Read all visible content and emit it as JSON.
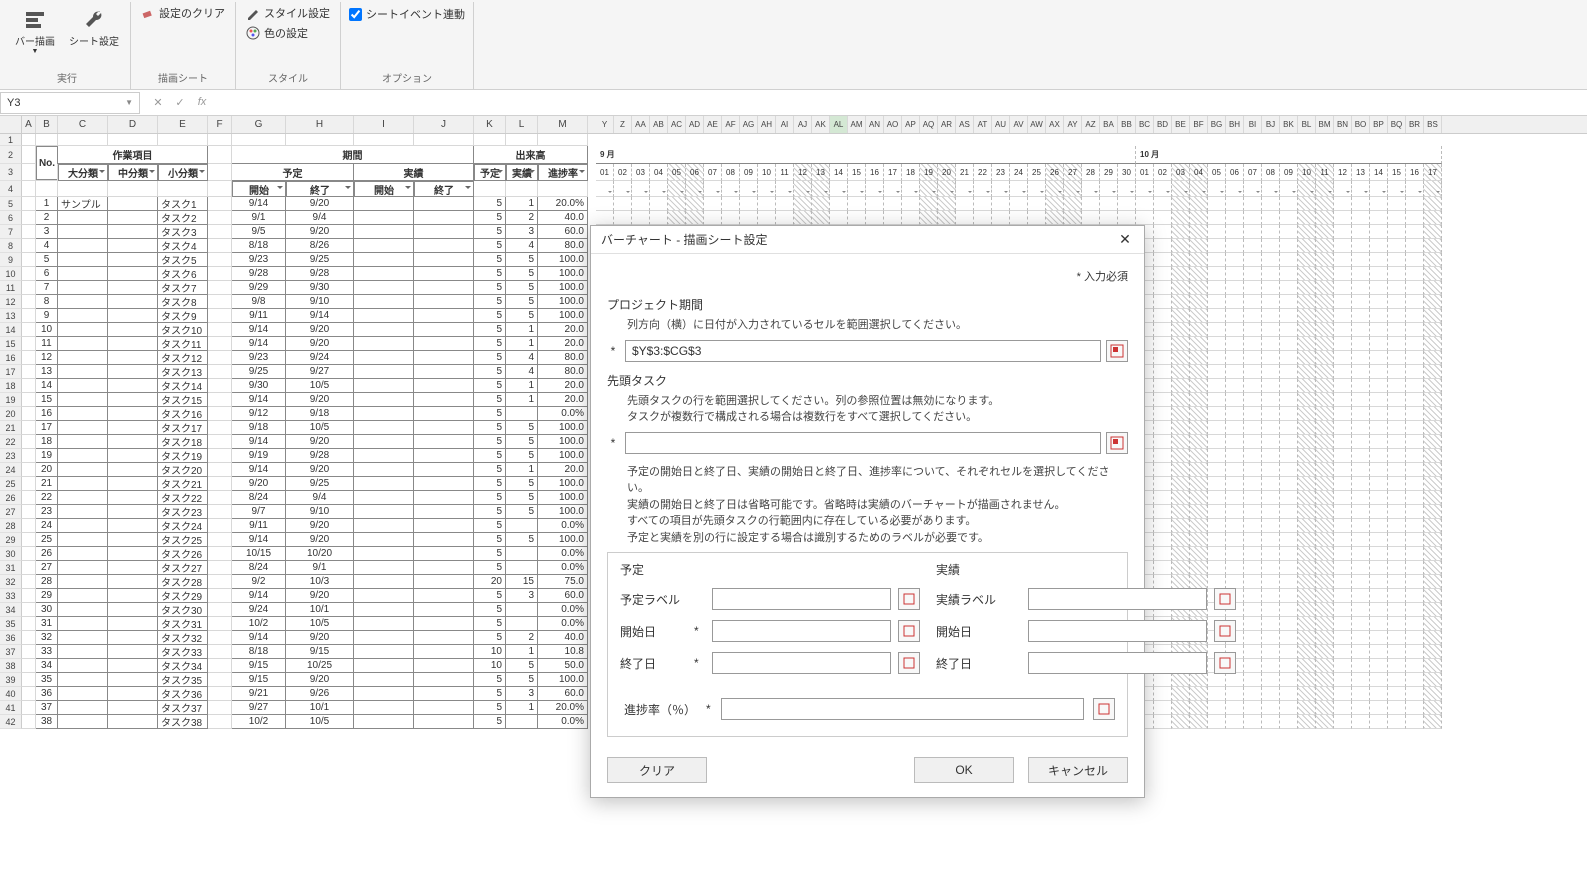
{
  "ribbon": {
    "group1": {
      "btn_bar": "バー描画",
      "btn_sheet": "シート設定",
      "label": "実行"
    },
    "group2": {
      "clear": "設定のクリア",
      "label": "描画シート"
    },
    "group3": {
      "style": "スタイル設定",
      "color": "色の設定",
      "label": "スタイル"
    },
    "group4": {
      "chk": "シートイベント連動",
      "label": "オプション"
    }
  },
  "formula": {
    "name": "Y3",
    "fx": "fx",
    "value": ""
  },
  "headers": {
    "main_cols": [
      "A",
      "B",
      "C",
      "D",
      "E",
      "F",
      "G",
      "H",
      "I",
      "J",
      "K",
      "L",
      "M"
    ],
    "tl_cols": [
      "Y",
      "Z",
      "AA",
      "AB",
      "AC",
      "AD",
      "AE",
      "AF",
      "AG",
      "AH",
      "AI",
      "AJ",
      "AK",
      "AL",
      "AM",
      "AN",
      "AO",
      "AP",
      "AQ",
      "AR",
      "AS",
      "AT",
      "AU",
      "AV",
      "AW",
      "AX",
      "AY",
      "AZ",
      "BA",
      "BB",
      "BC",
      "BD",
      "BE",
      "BF",
      "BG",
      "BH",
      "BI",
      "BJ",
      "BK",
      "BL",
      "BM",
      "BN",
      "BO",
      "BP",
      "BQ",
      "BR",
      "BS"
    ]
  },
  "table_hdr": {
    "no": "No.",
    "sagyo": "作業項目",
    "dai": "大分類",
    "chu": "中分類",
    "sho": "小分類",
    "kikan": "期間",
    "yotei": "予定",
    "jisseki": "実績",
    "kaishi": "開始",
    "shuryo": "終了",
    "dekidaka": "出来高",
    "shinchoku": "進捗率"
  },
  "months": {
    "m9": "9 月",
    "m10": "10 月"
  },
  "days9": [
    "01",
    "02",
    "03",
    "04",
    "05",
    "06",
    "07",
    "08",
    "09",
    "10",
    "11",
    "12",
    "13",
    "14",
    "15",
    "16",
    "17",
    "18",
    "19",
    "20",
    "21",
    "22",
    "23",
    "24",
    "25",
    "26",
    "27",
    "28",
    "29",
    "30"
  ],
  "days10": [
    "01",
    "02",
    "03",
    "04",
    "05",
    "06",
    "07",
    "08",
    "09",
    "10",
    "11",
    "12",
    "13",
    "14",
    "15",
    "16",
    "17"
  ],
  "tasks": [
    {
      "no": 1,
      "dai": "サンプル",
      "sho": "タスク1",
      "ps": "9/14",
      "pe": "9/20",
      "y": 5,
      "j": 1,
      "p": "20.0%"
    },
    {
      "no": 2,
      "dai": "",
      "sho": "タスク2",
      "ps": "9/1",
      "pe": "9/4",
      "y": 5,
      "j": 2,
      "p": "40.0"
    },
    {
      "no": 3,
      "dai": "",
      "sho": "タスク3",
      "ps": "9/5",
      "pe": "9/20",
      "y": 5,
      "j": 3,
      "p": "60.0"
    },
    {
      "no": 4,
      "dai": "",
      "sho": "タスク4",
      "ps": "8/18",
      "pe": "8/26",
      "y": 5,
      "j": 4,
      "p": "80.0"
    },
    {
      "no": 5,
      "dai": "",
      "sho": "タスク5",
      "ps": "9/23",
      "pe": "9/25",
      "y": 5,
      "j": 5,
      "p": "100.0"
    },
    {
      "no": 6,
      "dai": "",
      "sho": "タスク6",
      "ps": "9/28",
      "pe": "9/28",
      "y": 5,
      "j": 5,
      "p": "100.0"
    },
    {
      "no": 7,
      "dai": "",
      "sho": "タスク7",
      "ps": "9/29",
      "pe": "9/30",
      "y": 5,
      "j": 5,
      "p": "100.0"
    },
    {
      "no": 8,
      "dai": "",
      "sho": "タスク8",
      "ps": "9/8",
      "pe": "9/10",
      "y": 5,
      "j": 5,
      "p": "100.0"
    },
    {
      "no": 9,
      "dai": "",
      "sho": "タスク9",
      "ps": "9/11",
      "pe": "9/14",
      "y": 5,
      "j": 5,
      "p": "100.0"
    },
    {
      "no": 10,
      "dai": "",
      "sho": "タスク10",
      "ps": "9/14",
      "pe": "9/20",
      "y": 5,
      "j": 1,
      "p": "20.0"
    },
    {
      "no": 11,
      "dai": "",
      "sho": "タスク11",
      "ps": "9/14",
      "pe": "9/20",
      "y": 5,
      "j": 1,
      "p": "20.0"
    },
    {
      "no": 12,
      "dai": "",
      "sho": "タスク12",
      "ps": "9/23",
      "pe": "9/24",
      "y": 5,
      "j": 4,
      "p": "80.0"
    },
    {
      "no": 13,
      "dai": "",
      "sho": "タスク13",
      "ps": "9/25",
      "pe": "9/27",
      "y": 5,
      "j": 4,
      "p": "80.0"
    },
    {
      "no": 14,
      "dai": "",
      "sho": "タスク14",
      "ps": "9/30",
      "pe": "10/5",
      "y": 5,
      "j": 1,
      "p": "20.0"
    },
    {
      "no": 15,
      "dai": "",
      "sho": "タスク15",
      "ps": "9/14",
      "pe": "9/20",
      "y": 5,
      "j": 1,
      "p": "20.0"
    },
    {
      "no": 16,
      "dai": "",
      "sho": "タスク16",
      "ps": "9/12",
      "pe": "9/18",
      "y": 5,
      "j": "",
      "p": "0.0%"
    },
    {
      "no": 17,
      "dai": "",
      "sho": "タスク17",
      "ps": "9/18",
      "pe": "10/5",
      "y": 5,
      "j": 5,
      "p": "100.0"
    },
    {
      "no": 18,
      "dai": "",
      "sho": "タスク18",
      "ps": "9/14",
      "pe": "9/20",
      "y": 5,
      "j": 5,
      "p": "100.0"
    },
    {
      "no": 19,
      "dai": "",
      "sho": "タスク19",
      "ps": "9/19",
      "pe": "9/28",
      "y": 5,
      "j": 5,
      "p": "100.0"
    },
    {
      "no": 20,
      "dai": "",
      "sho": "タスク20",
      "ps": "9/14",
      "pe": "9/20",
      "y": 5,
      "j": 1,
      "p": "20.0"
    },
    {
      "no": 21,
      "dai": "",
      "sho": "タスク21",
      "ps": "9/20",
      "pe": "9/25",
      "y": 5,
      "j": 5,
      "p": "100.0"
    },
    {
      "no": 22,
      "dai": "",
      "sho": "タスク22",
      "ps": "8/24",
      "pe": "9/4",
      "y": 5,
      "j": 5,
      "p": "100.0"
    },
    {
      "no": 23,
      "dai": "",
      "sho": "タスク23",
      "ps": "9/7",
      "pe": "9/10",
      "y": 5,
      "j": 5,
      "p": "100.0"
    },
    {
      "no": 24,
      "dai": "",
      "sho": "タスク24",
      "ps": "9/11",
      "pe": "9/20",
      "y": 5,
      "j": "",
      "p": "0.0%"
    },
    {
      "no": 25,
      "dai": "",
      "sho": "タスク25",
      "ps": "9/14",
      "pe": "9/20",
      "y": 5,
      "j": 5,
      "p": "100.0"
    },
    {
      "no": 26,
      "dai": "",
      "sho": "タスク26",
      "ps": "10/15",
      "pe": "10/20",
      "y": 5,
      "j": "",
      "p": "0.0%"
    },
    {
      "no": 27,
      "dai": "",
      "sho": "タスク27",
      "ps": "8/24",
      "pe": "9/1",
      "y": 5,
      "j": "",
      "p": "0.0%"
    },
    {
      "no": 28,
      "dai": "",
      "sho": "タスク28",
      "ps": "9/2",
      "pe": "10/3",
      "y": 20,
      "j": 15,
      "p": "75.0"
    },
    {
      "no": 29,
      "dai": "",
      "sho": "タスク29",
      "ps": "9/14",
      "pe": "9/20",
      "y": 5,
      "j": 3,
      "p": "60.0"
    },
    {
      "no": 30,
      "dai": "",
      "sho": "タスク30",
      "ps": "9/24",
      "pe": "10/1",
      "y": 5,
      "j": "",
      "p": "0.0%"
    },
    {
      "no": 31,
      "dai": "",
      "sho": "タスク31",
      "ps": "10/2",
      "pe": "10/5",
      "y": 5,
      "j": "",
      "p": "0.0%"
    },
    {
      "no": 32,
      "dai": "",
      "sho": "タスク32",
      "ps": "9/14",
      "pe": "9/20",
      "y": 5,
      "j": 2,
      "p": "40.0"
    },
    {
      "no": 33,
      "dai": "",
      "sho": "タスク33",
      "ps": "8/18",
      "pe": "9/15",
      "y": 10,
      "j": 1,
      "p": "10.8"
    },
    {
      "no": 34,
      "dai": "",
      "sho": "タスク34",
      "ps": "9/15",
      "pe": "10/25",
      "y": 10,
      "j": 5,
      "p": "50.0"
    },
    {
      "no": 35,
      "dai": "",
      "sho": "タスク35",
      "ps": "9/15",
      "pe": "9/20",
      "y": 5,
      "j": 5,
      "p": "100.0"
    },
    {
      "no": 36,
      "dai": "",
      "sho": "タスク36",
      "ps": "9/21",
      "pe": "9/26",
      "y": 5,
      "j": 3,
      "p": "60.0"
    },
    {
      "no": 37,
      "dai": "",
      "sho": "タスク37",
      "ps": "9/27",
      "pe": "10/1",
      "y": 5,
      "j": 1,
      "p": "20.0%"
    },
    {
      "no": 38,
      "dai": "",
      "sho": "タスク38",
      "ps": "10/2",
      "pe": "10/5",
      "y": 5,
      "j": "",
      "p": "0.0%"
    }
  ],
  "dialog": {
    "title": "バーチャート - 描画シート設定",
    "req_note": "* 入力必須",
    "section_period": "プロジェクト期間",
    "period_help": "列方向（横）に日付が入力されているセルを範囲選択してください。",
    "period_value": "$Y$3:$CG$3",
    "section_head": "先頭タスク",
    "head_help1": "先頭タスクの行を範囲選択してください。列の参照位置は無効になります。",
    "head_help2": "タスクが複数行で構成される場合は複数行をすべて選択してください。",
    "head_value": "",
    "block_help1": "予定の開始日と終了日、実績の開始日と終了日、進捗率について、それぞれセルを選択してください。",
    "block_help2": "実績の開始日と終了日は省略可能です。省略時は実績のバーチャートが描画されません。",
    "block_help3": "すべての項目が先頭タスクの行範囲内に存在している必要があります。",
    "block_help4": "予定と実績を別の行に設定する場合は識別するためのラベルが必要です。",
    "fs_yotei": "予定",
    "fs_jisseki": "実績",
    "lbl_yotei_label": "予定ラベル",
    "lbl_jisseki_label": "実績ラベル",
    "lbl_start": "開始日",
    "lbl_end": "終了日",
    "lbl_progress": "進捗率（％）",
    "btn_clear": "クリア",
    "btn_ok": "OK",
    "btn_cancel": "キャンセル"
  },
  "weekend_cols_9": [
    4,
    5,
    11,
    12,
    18,
    19,
    25,
    26
  ],
  "weekend_cols_10": [
    2,
    3,
    9,
    10,
    16,
    17
  ]
}
